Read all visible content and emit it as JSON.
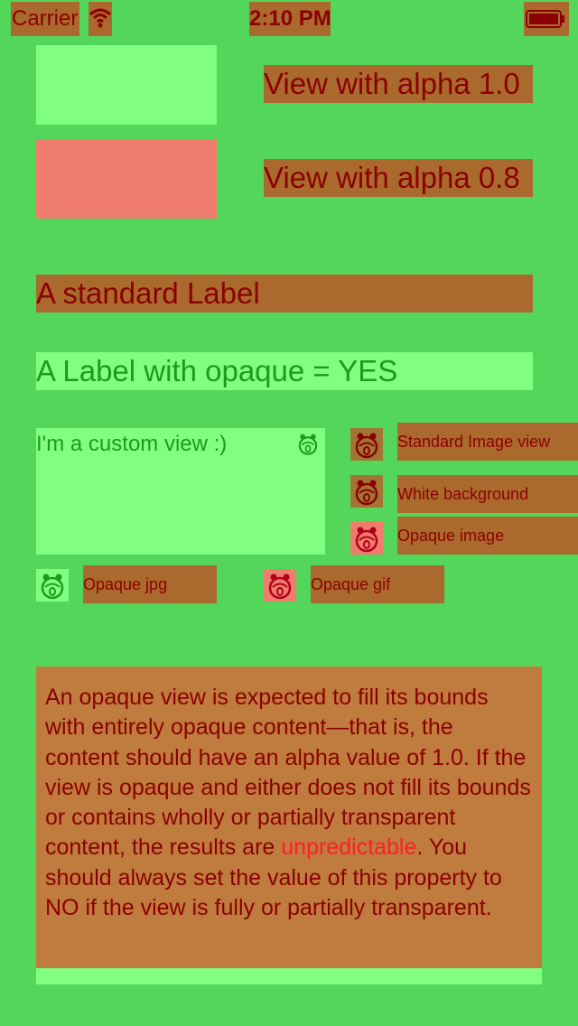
{
  "status_bar": {
    "carrier": "Carrier",
    "time": "2:10 PM",
    "wifi_icon": "wifi-icon",
    "battery_icon": "battery-icon"
  },
  "views": {
    "alpha_1_label": "View with alpha 1.0",
    "alpha_08_label": "View with alpha 0.8"
  },
  "labels": {
    "standard": "A standard Label",
    "opaque": "A Label with opaque = YES"
  },
  "custom_view": {
    "text": "I'm a custom view :)",
    "icon": "bug-face-icon"
  },
  "image_views": [
    {
      "label": "Standard Image view",
      "icon": "bug-face-icon"
    },
    {
      "label": "White background",
      "icon": "bug-face-icon"
    },
    {
      "label": "Opaque image",
      "icon": "bug-face-icon"
    },
    {
      "label": "Opaque jpg",
      "icon": "bug-face-icon"
    },
    {
      "label": "Opaque gif",
      "icon": "bug-face-icon"
    }
  ],
  "paragraph": {
    "part1": "An opaque view is expected to fill its bounds with entirely opaque content—that is, the content should have an alpha value of 1.0. If the view is opaque and either does not fill its bounds or contains wholly or partially transparent content, the results are ",
    "highlight": "unpredictable",
    "part2": ". You should always set the value of this property to NO if the view is fully or partially transparent."
  },
  "colors": {
    "background": "#53d65a",
    "blended_overlay": "#ab6a2d",
    "opaque_green": "#80ff80",
    "opaque_red": "#ef7c6c",
    "text_dark_red": "#8b0000",
    "text_green": "#1b9a1b",
    "highlight_red": "#ff2020"
  }
}
